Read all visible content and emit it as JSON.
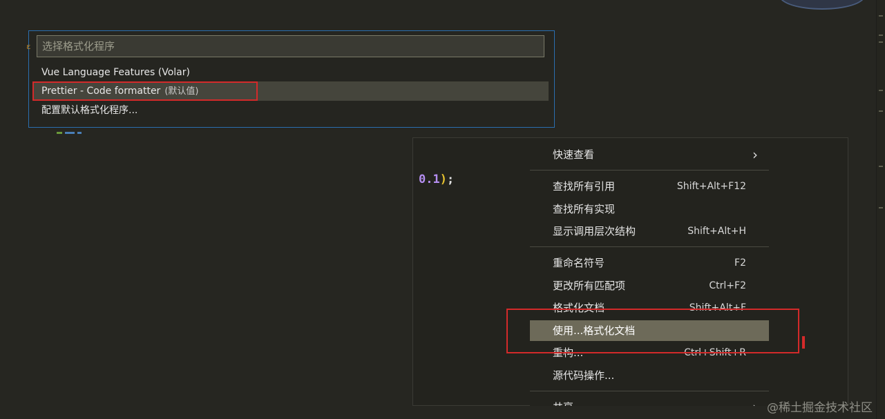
{
  "quick_pick": {
    "placeholder": "选择格式化程序",
    "items": [
      {
        "label": "Vue Language Features (Volar)",
        "detail": ""
      },
      {
        "label": "Prettier - Code formatter",
        "detail": "(默认值)"
      },
      {
        "label": "配置默认格式化程序...",
        "detail": ""
      }
    ],
    "selected_index": 1
  },
  "editor": {
    "code_tokens": {
      "number": "0.1",
      "paren": ")",
      "semi": ";"
    }
  },
  "context_menu": {
    "items": [
      {
        "label": "快速查看",
        "key": ""
      },
      {
        "label": "查找所有引用",
        "key": "Shift+Alt+F12"
      },
      {
        "label": "查找所有实现",
        "key": ""
      },
      {
        "label": "显示调用层次结构",
        "key": "Shift+Alt+H"
      },
      {
        "label": "重命名符号",
        "key": "F2"
      },
      {
        "label": "更改所有匹配项",
        "key": "Ctrl+F2"
      },
      {
        "label": "格式化文档",
        "key": "Shift+Alt+F"
      },
      {
        "label": "使用...格式化文档",
        "key": ""
      },
      {
        "label": "重构...",
        "key": "Ctrl+Shift+R"
      },
      {
        "label": "源代码操作...",
        "key": ""
      },
      {
        "label": "共享",
        "key": ""
      }
    ],
    "selected_index": 7
  },
  "colors": {
    "highlight_red": "#d42a2a",
    "focus_border": "#2a6fb0",
    "menu_selected": "#6d6a59"
  },
  "watermark": "@稀土掘金技术社区"
}
